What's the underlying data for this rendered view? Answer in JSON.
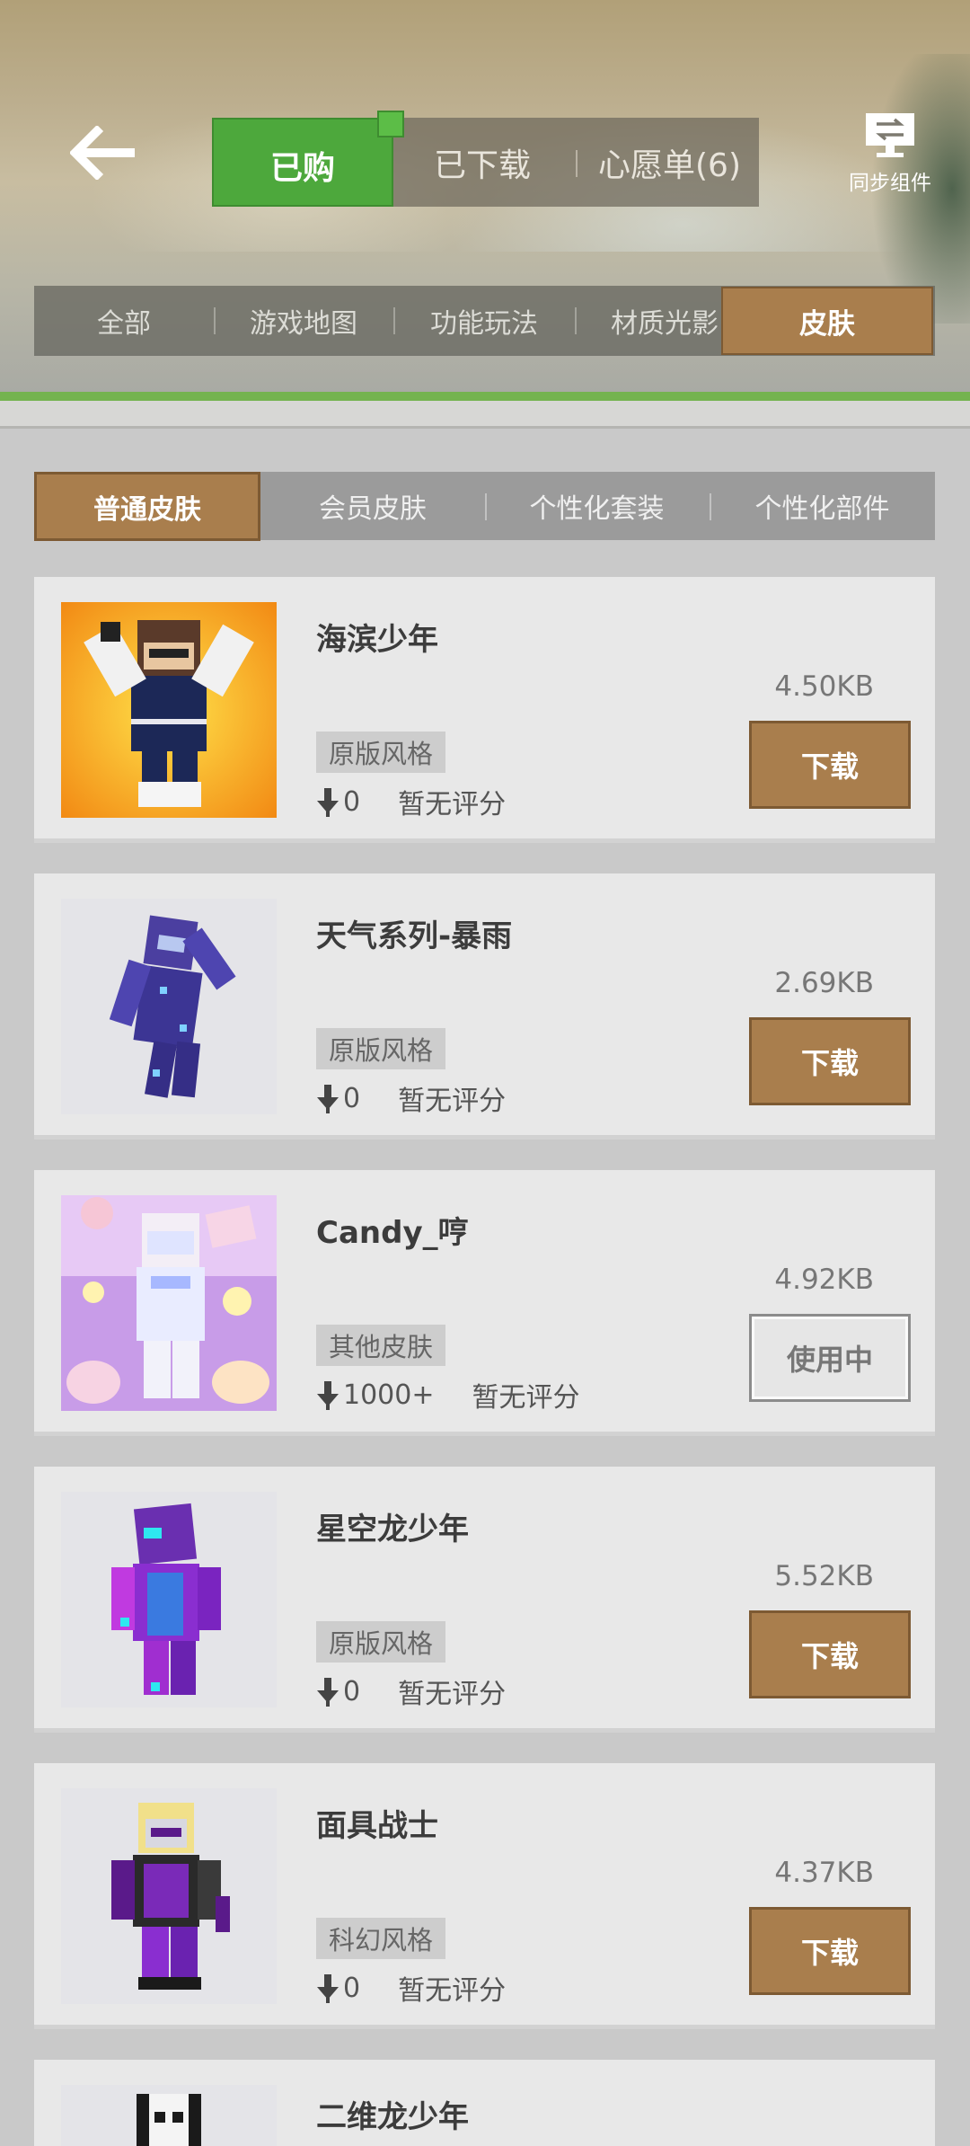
{
  "header": {
    "tabs": [
      {
        "label": "已购",
        "active": true
      },
      {
        "label": "已下载",
        "active": false
      },
      {
        "label": "心愿单(6)",
        "active": false
      }
    ],
    "sync_label": "同步组件",
    "back_icon": "back-arrow-icon",
    "sync_icon": "sync-monitor-icon"
  },
  "categories": [
    {
      "label": "全部",
      "active": false
    },
    {
      "label": "游戏地图",
      "active": false
    },
    {
      "label": "功能玩法",
      "active": false
    },
    {
      "label": "材质光影",
      "active": false
    },
    {
      "label": "皮肤",
      "active": true
    }
  ],
  "subcategories": [
    {
      "label": "普通皮肤",
      "active": true
    },
    {
      "label": "会员皮肤",
      "active": false
    },
    {
      "label": "个性化套装",
      "active": false
    },
    {
      "label": "个性化部件",
      "active": false
    }
  ],
  "items": [
    {
      "name": "海滨少年",
      "tag": "原版风格",
      "downloads": "0",
      "rating": "暂无评分",
      "size": "4.50KB",
      "action": "下载",
      "in_use": false
    },
    {
      "name": "天气系列-暴雨",
      "tag": "原版风格",
      "downloads": "0",
      "rating": "暂无评分",
      "size": "2.69KB",
      "action": "下载",
      "in_use": false
    },
    {
      "name": "Candy_哼",
      "tag": "其他皮肤",
      "downloads": "1000+",
      "rating": "暂无评分",
      "size": "4.92KB",
      "action": "使用中",
      "in_use": true
    },
    {
      "name": "星空龙少年",
      "tag": "原版风格",
      "downloads": "0",
      "rating": "暂无评分",
      "size": "5.52KB",
      "action": "下载",
      "in_use": false
    },
    {
      "name": "面具战士",
      "tag": "科幻风格",
      "downloads": "0",
      "rating": "暂无评分",
      "size": "4.37KB",
      "action": "下载",
      "in_use": false
    },
    {
      "name": "二维龙少年"
    }
  ],
  "colors": {
    "active_tab_green": "#4da83c",
    "accent_brown": "#a97e4d",
    "card_bg": "#e8e8e8"
  }
}
